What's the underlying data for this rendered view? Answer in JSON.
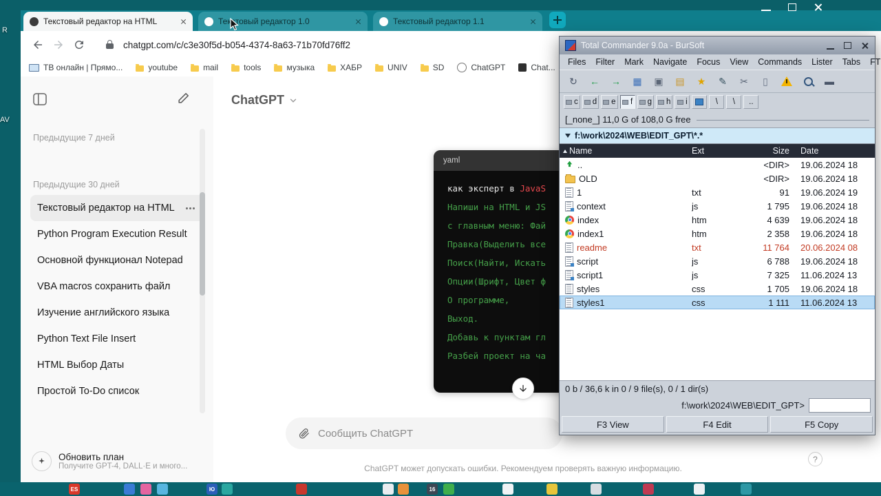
{
  "colors": {
    "desktop_teal": "#0b5f68",
    "chrome_teal": "#0f7e8c",
    "code_green": "#45a049",
    "code_accent_red": "#e5484d",
    "readme_red": "#c23a22",
    "selection_blue": "#b9dbf5",
    "warning_yellow": "#f4b400"
  },
  "desktop": {
    "labels": [
      "R",
      "AV"
    ]
  },
  "browser": {
    "tabs": [
      {
        "title": "Текстовый редактор на HTML"
      },
      {
        "title": "Текстовый редактор 1.0"
      },
      {
        "title": "Текстовый редактор 1.1"
      }
    ],
    "url": "chatgpt.com/c/c3e30f5d-b054-4374-8a63-71b70fd76ff2",
    "bookmarks": [
      "ТВ онлайн | Прямо...",
      "youtube",
      "mail",
      "tools",
      "музыка",
      "ХАБР",
      "UNIV",
      "SD",
      "ChatGPT",
      "Chat..."
    ]
  },
  "chatgpt": {
    "title": "ChatGPT",
    "sidebar": {
      "section_recent": "Предыдущие 7 дней",
      "section_month": "Предыдущие 30 дней",
      "items": [
        "Текстовый редактор на HTML",
        "Python Program Execution Result",
        "Основной функционал Notepad",
        "VBA macros сохранить файл",
        "Изучение английского языка",
        "Python Text File Insert",
        "HTML Выбор Даты",
        "Простой To-Do список"
      ],
      "upgrade_title": "Обновить план",
      "upgrade_subtitle": "Получите GPT-4, DALL·E и много..."
    },
    "code": {
      "lang": "yaml",
      "line1_plain": "как эксперт в ",
      "line1_accent": "JavaS",
      "lines": [
        "Напиши на HTML и JS",
        "с главным меню: Фай",
        "Правка(Выделить все",
        "Поиск(Найти, Искать",
        "Опции(Шрифт, Цвет ф",
        "О программе,",
        "Выход.",
        "Добавь к пунктам гл",
        "Разбей проект на ча"
      ]
    },
    "input_placeholder": "Сообщить ChatGPT",
    "footer": "ChatGPT может допускать ошибки. Рекомендуем проверять важную информацию.",
    "help": "?"
  },
  "tc": {
    "title": "Total Commander 9.0a - BurSoft",
    "menu": [
      "Files",
      "Filter",
      "Mark",
      "Navigate",
      "Focus",
      "View",
      "Commands",
      "Lister",
      "Tabs",
      "FTP"
    ],
    "toolbar_icons": [
      "refresh",
      "back",
      "forward",
      "disk",
      "copy",
      "folder",
      "star",
      "edit",
      "cut",
      "clipboard",
      "warning",
      "search",
      "notes"
    ],
    "drives": [
      "c",
      "d",
      "e",
      "f",
      "g",
      "h",
      "i"
    ],
    "drive_extras": [
      "\\",
      "\\",
      ".."
    ],
    "free": "[_none_]  11,0 G of 108,0 G free",
    "path": "f:\\work\\2024\\WEB\\EDIT_GPT\\*.*",
    "columns": {
      "name": "Name",
      "ext": "Ext",
      "size": "Size",
      "date": "Date"
    },
    "files": [
      {
        "name": "..",
        "ext": "",
        "size": "<DIR>",
        "date": "19.06.2024 18"
      },
      {
        "name": "OLD",
        "ext": "",
        "size": "<DIR>",
        "date": "19.06.2024 18"
      },
      {
        "name": "1",
        "ext": "txt",
        "size": "91",
        "date": "19.06.2024 19"
      },
      {
        "name": "context",
        "ext": "js",
        "size": "1 795",
        "date": "19.06.2024 18"
      },
      {
        "name": "index",
        "ext": "htm",
        "size": "4 639",
        "date": "19.06.2024 18"
      },
      {
        "name": "index1",
        "ext": "htm",
        "size": "2 358",
        "date": "19.06.2024 18"
      },
      {
        "name": "readme",
        "ext": "txt",
        "size": "11 764",
        "date": "20.06.2024 08"
      },
      {
        "name": "script",
        "ext": "js",
        "size": "6 788",
        "date": "19.06.2024 18"
      },
      {
        "name": "script1",
        "ext": "js",
        "size": "7 325",
        "date": "11.06.2024 13"
      },
      {
        "name": "styles",
        "ext": "css",
        "size": "1 705",
        "date": "19.06.2024 18"
      },
      {
        "name": "styles1",
        "ext": "css",
        "size": "1 111",
        "date": "11.06.2024 13"
      }
    ],
    "status": "0 b / 36,6 k in 0 / 9 file(s), 0 / 1 dir(s)",
    "prompt": "f:\\work\\2024\\WEB\\EDIT_GPT>",
    "fkeys": [
      "F3 View",
      "F4 Edit",
      "F5 Copy"
    ]
  },
  "taskbar": {
    "labels": [
      "ES",
      "Ю",
      "16"
    ]
  }
}
